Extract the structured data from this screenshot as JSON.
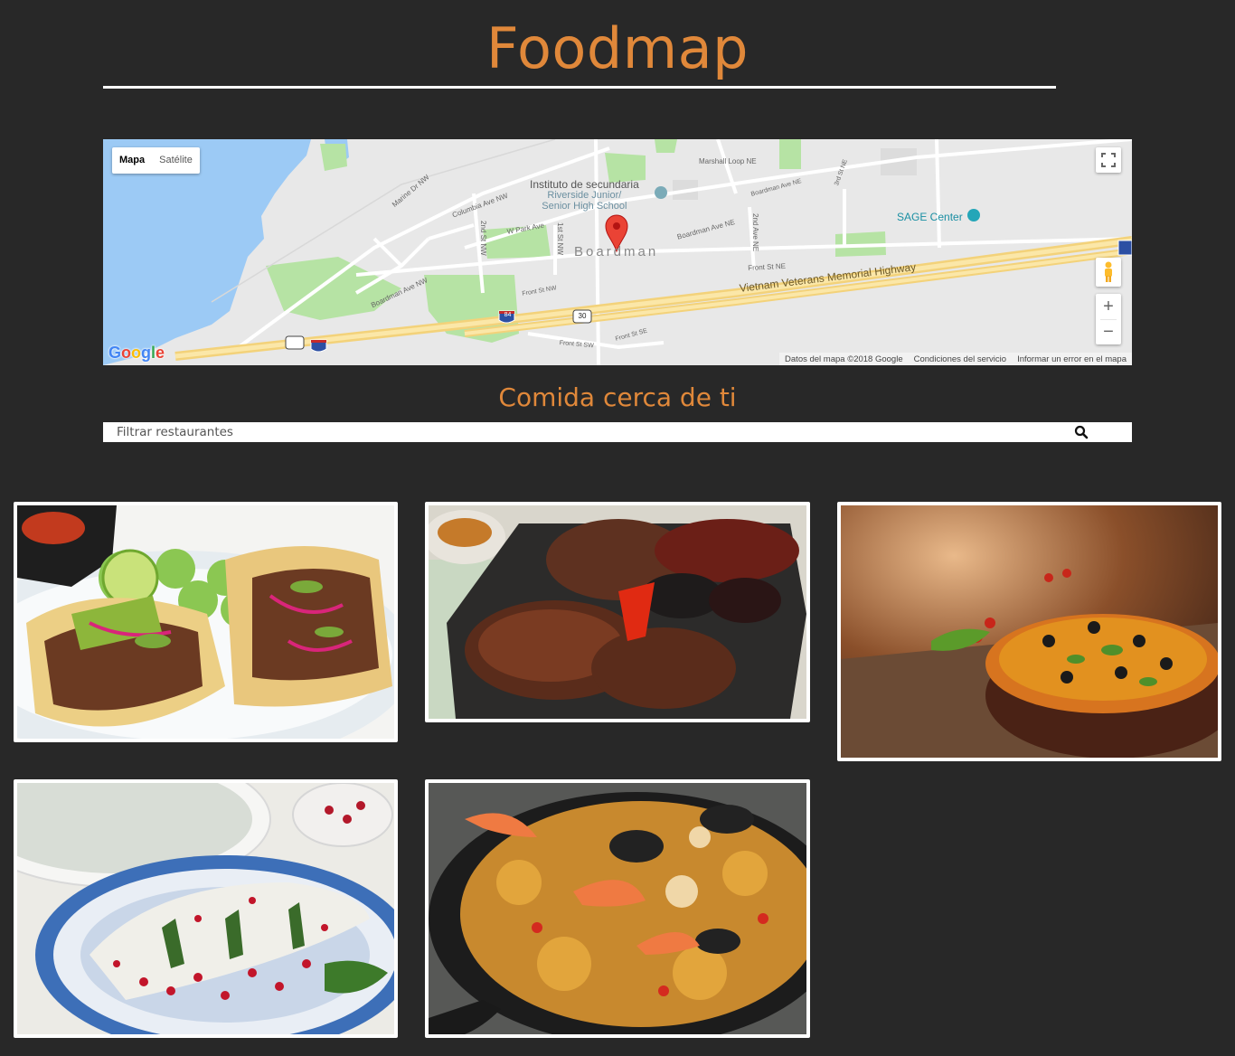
{
  "header": {
    "title": "Foodmap"
  },
  "map": {
    "type_buttons": {
      "map": "Mapa",
      "satellite": "Satélite"
    },
    "labels": {
      "school_line1": "Instituto de secundaria",
      "school_line2": "Riverside Junior/",
      "school_line3": "Senior High School",
      "town": "Boardman",
      "sage": "SAGE Center",
      "highway": "Vietnam Veterans Memorial Highway",
      "columbia_ave": "Columbia Ave NW",
      "marine_dr": "Marine Dr NW",
      "w_park_ave": "W Park Ave",
      "st2_nw": "2nd St NW",
      "st1_nw": "1st St NW",
      "boardman_ave_ne": "Boardman Ave NE",
      "boardman_ave_ne2": "Boardman Ave NE",
      "marshall_loop": "Marshall Loop NE",
      "st2_ne": "2nd Ave NE",
      "st3_ne": "3rd St NE",
      "front_st_ne": "Front St NE",
      "front_st_nw": "Front St NW",
      "boardman_ave_nw": "Boardman Ave NW",
      "front_st_sw": "Front St SW",
      "front_st_se": "Front St SE",
      "shield_84": "84",
      "shield_30": "30"
    },
    "attribution": {
      "data": "Datos del mapa ©2018 Google",
      "terms": "Condiciones del servicio",
      "report": "Informar un error en el mapa"
    },
    "logo": "Google"
  },
  "section": {
    "title": "Comida cerca de ti",
    "filter_placeholder": "Filtrar restaurantes"
  },
  "restaurants": [
    {
      "dish": "tacos"
    },
    {
      "dish": "parrillada"
    },
    {
      "dish": "pizza"
    },
    {
      "dish": "chiles en nogada"
    },
    {
      "dish": "paella"
    }
  ],
  "colors": {
    "background": "#282828",
    "accent": "#e0883a",
    "card_border": "#ffffff"
  }
}
